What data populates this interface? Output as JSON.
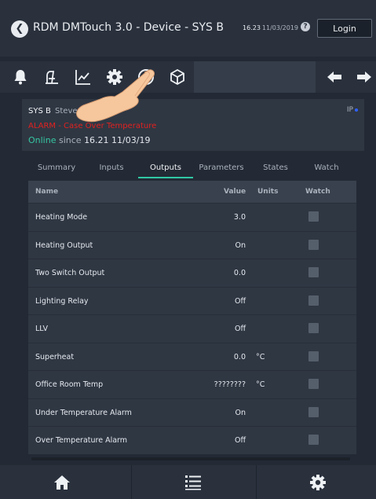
{
  "app": {
    "title": "RDM DMTouch 3.0 - Device - SYS B",
    "time": "16.23",
    "date": "11/03/2019",
    "help_label": "?",
    "login_label": "Login"
  },
  "toolbar": {
    "icons": [
      "bell-icon",
      "gauge-icon",
      "chart-icon",
      "gear-icon",
      "record-icon",
      "cube-icon"
    ],
    "nav": [
      "arrow-left-icon",
      "arrow-right-icon"
    ]
  },
  "device": {
    "name": "SYS B",
    "description": "Steves Test",
    "ip_label": "IP",
    "alarm_text": "ALARM - Case Over Temperature",
    "status": "Online",
    "since_label": "since",
    "since_value": "16.21 11/03/19"
  },
  "tabs": [
    "Summary",
    "Inputs",
    "Outputs",
    "Parameters",
    "States",
    "Watch"
  ],
  "active_tab": "Outputs",
  "table": {
    "headers": {
      "name": "Name",
      "value": "Value",
      "units": "Units",
      "watch": "Watch"
    },
    "rows": [
      {
        "name": "Heating Mode",
        "value": "3.0",
        "unit": ""
      },
      {
        "name": "Heating Output",
        "value": "On",
        "unit": ""
      },
      {
        "name": "Two Switch Output",
        "value": "0.0",
        "unit": ""
      },
      {
        "name": "Lighting Relay",
        "value": "Off",
        "unit": ""
      },
      {
        "name": "LLV",
        "value": "Off",
        "unit": ""
      },
      {
        "name": "Superheat",
        "value": "0.0",
        "unit": "°C"
      },
      {
        "name": "Office Room Temp",
        "value": "????????",
        "unit": "°C"
      },
      {
        "name": "Under Temperature Alarm",
        "value": "On",
        "unit": ""
      },
      {
        "name": "Over Temperature Alarm",
        "value": "Off",
        "unit": ""
      }
    ]
  },
  "bottom_nav": [
    "home-icon",
    "list-icon",
    "settings-icon"
  ],
  "colors": {
    "accent": "#30c8a4",
    "alarm": "#e2211f",
    "online": "#36c7a1",
    "background": "#232a35"
  }
}
